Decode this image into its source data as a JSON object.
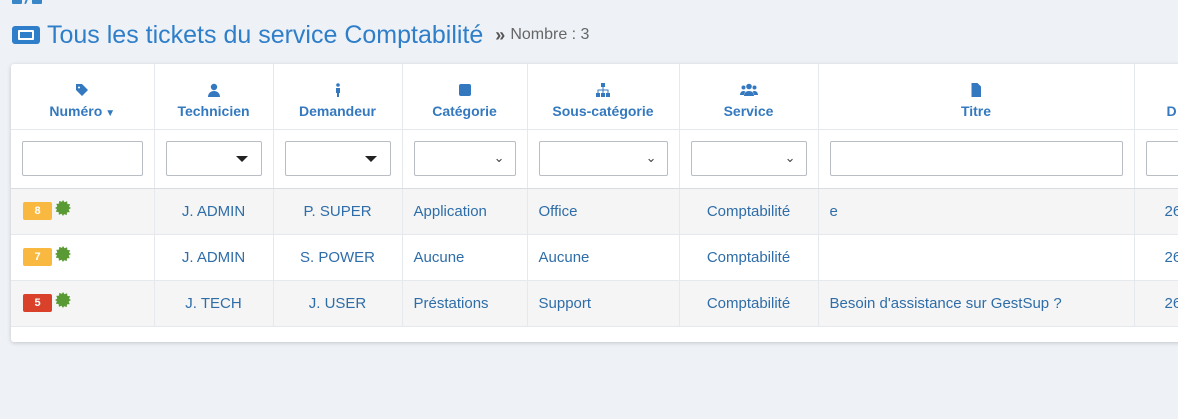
{
  "page": {
    "title": "Tous les tickets du service Comptabilité",
    "count_label": "Nombre : 3"
  },
  "colors": {
    "accent": "#2e7ec9",
    "header_text": "#3479bf",
    "badge_orange": "#f9b940",
    "badge_red": "#d9412b",
    "state_green": "#5a9a35"
  },
  "columns": [
    {
      "label": "Numéro",
      "icon": "tag-icon",
      "sorted": true
    },
    {
      "label": "Technicien",
      "icon": "user-icon"
    },
    {
      "label": "Demandeur",
      "icon": "person-standing-icon"
    },
    {
      "label": "Catégorie",
      "icon": "square-icon"
    },
    {
      "label": "Sous-catégorie",
      "icon": "sitemap-icon"
    },
    {
      "label": "Service",
      "icon": "users-icon"
    },
    {
      "label": "Titre",
      "icon": "file-icon"
    },
    {
      "label": "D",
      "icon": "calendar-icon"
    }
  ],
  "rows": [
    {
      "number": "8",
      "priority_color": "#f9b940",
      "technicien": "J. ADMIN",
      "demandeur": "P. SUPER",
      "categorie": "Application",
      "sous_categorie": "Office",
      "service": "Comptabilité",
      "titre": "e",
      "date": "26"
    },
    {
      "number": "7",
      "priority_color": "#f9b940",
      "technicien": "J. ADMIN",
      "demandeur": "S. POWER",
      "categorie": "Aucune",
      "sous_categorie": "Aucune",
      "service": "Comptabilité",
      "titre": "",
      "date": "26"
    },
    {
      "number": "5",
      "priority_color": "#d9412b",
      "technicien": "J. TECH",
      "demandeur": "J. USER",
      "categorie": "Préstations",
      "sous_categorie": "Support",
      "service": "Comptabilité",
      "titre": "Besoin d'assistance sur GestSup ?",
      "date": "26"
    }
  ]
}
